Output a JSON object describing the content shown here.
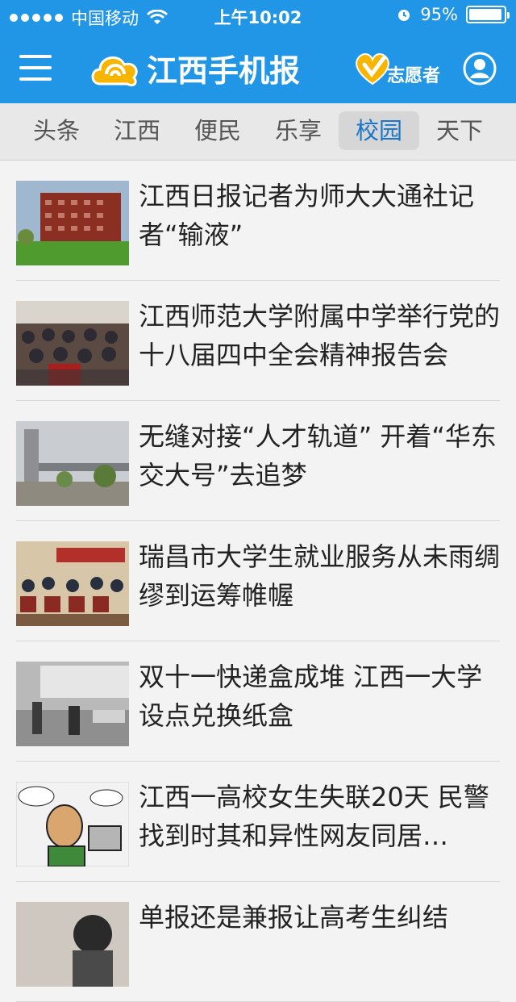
{
  "status": {
    "carrier": "中国移动",
    "time": "上午10:02",
    "battery": "95%",
    "battery_level": 0.95
  },
  "header": {
    "app_title": "江西手机报",
    "volunteer_label": "志愿者"
  },
  "tabs": [
    {
      "label": "头条",
      "active": false
    },
    {
      "label": "江西",
      "active": false
    },
    {
      "label": "便民",
      "active": false
    },
    {
      "label": "乐享",
      "active": false
    },
    {
      "label": "校园",
      "active": true
    },
    {
      "label": "天下",
      "active": false
    }
  ],
  "news": [
    {
      "title": "江西日报记者为师大大通社记者“输液”",
      "thumb": "building-photo"
    },
    {
      "title": "江西师范大学附属中学举行党的十八届四中全会精神报告会",
      "thumb": "meeting-photo"
    },
    {
      "title": "无缝对接“人才轨道” 开着“华东交大号”去追梦",
      "thumb": "gate-photo"
    },
    {
      "title": "瑞昌市大学生就业服务从未雨绸缪到运筹帷幄",
      "thumb": "auditorium-photo"
    },
    {
      "title": "双十一快递盒成堆 江西一大学设点兑换纸盒",
      "thumb": "street-photo"
    },
    {
      "title": "江西一高校女生失联20天 民警找到时其和异性网友同居…",
      "thumb": "cartoon-photo"
    },
    {
      "title": "单报还是兼报让高考生纠结",
      "thumb": "person-photo"
    }
  ],
  "colors": {
    "header_bg": "#2196e6",
    "active_tab": "#1976c9",
    "logo_yellow": "#f7b500"
  },
  "icons": {
    "menu": "hamburger-icon",
    "wifi": "wifi-icon",
    "alarm": "alarm-icon",
    "battery": "battery-icon",
    "logo": "cloud-logo-icon",
    "volunteer": "heart-icon",
    "user": "user-icon"
  }
}
